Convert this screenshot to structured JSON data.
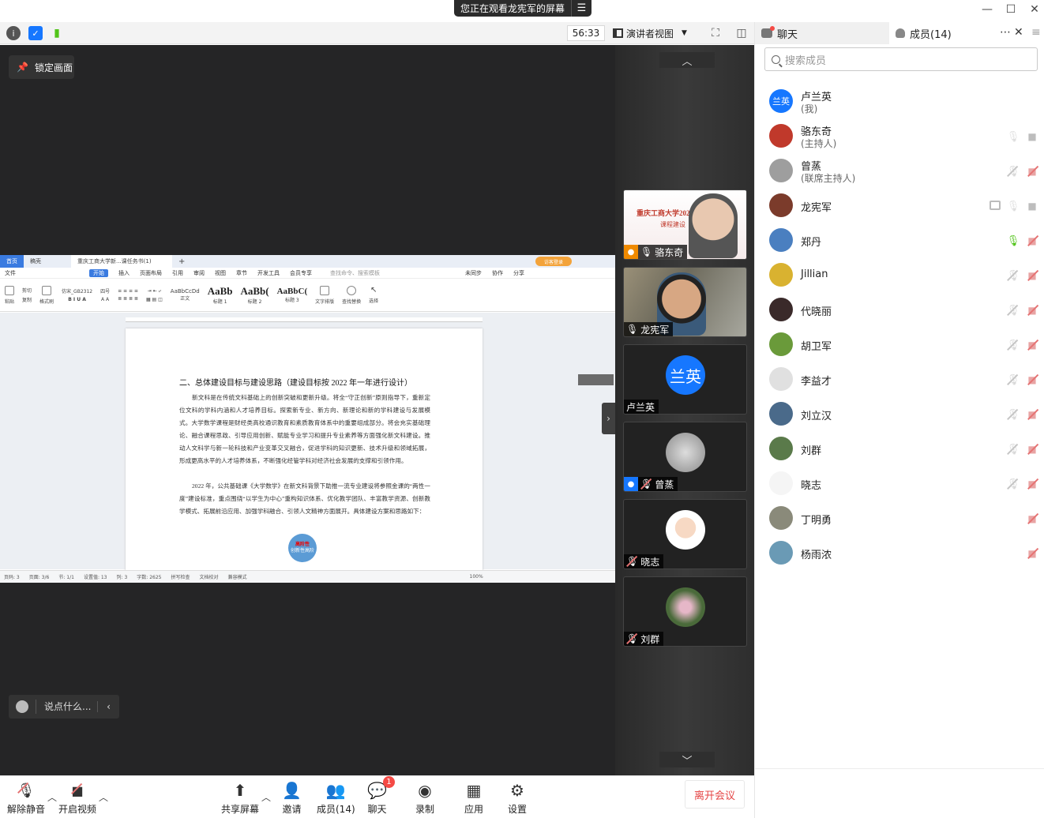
{
  "banner": {
    "text": "您正在观看龙宪军的屏幕",
    "menu_icon": "list-icon"
  },
  "toolbar": {
    "timer": "56:33",
    "view_label": "演讲者视图",
    "icons": [
      "info-icon",
      "shield-icon",
      "signal-icon",
      "fullscreen-icon",
      "layout-icon"
    ]
  },
  "stage": {
    "lock_label": "锁定画面",
    "chat_placeholder": "说点什么..."
  },
  "document": {
    "tabs": [
      "首页",
      "稿壳",
      "重庆工商大学新...课任务书(1)"
    ],
    "login_label": "访客登录",
    "menu": [
      "文件",
      "开始",
      "插入",
      "页面布局",
      "引用",
      "审阅",
      "视图",
      "章节",
      "开发工具",
      "会员专享"
    ],
    "search_placeholder": "查找命令、搜索模板",
    "menu_right": [
      "未同步",
      "协作",
      "分享"
    ],
    "ribbon_font": "仿宋_GB2312",
    "ribbon_size": "四号",
    "ribbon_left": [
      "粘贴",
      "剪切",
      "复制",
      "格式刷"
    ],
    "styles": [
      {
        "sample": "AaBbCcDd",
        "name": "正文"
      },
      {
        "sample": "AaBb",
        "name": "标题 1"
      },
      {
        "sample": "AaBb(",
        "name": "标题 2"
      },
      {
        "sample": "AaBbC(",
        "name": "标题 3"
      }
    ],
    "ribbon_right": [
      "文字排版",
      "查找替换",
      "选择"
    ],
    "heading": "二、总体建设目标与建设思路（建设目标按 2022 年一年进行设计）",
    "paragraph1": "新文科是在传统文科基础上的创新突破和更新升级。将全“守正创新”原则指导下，重新定位文科的学科内涵和人才培养目标。探索新专业、新方向、新理论和新的学科建设与发展模式。大学数学课程是财经类高校通识教育和素质教育体系中的重要组成部分。将会充实基础理论、融合课程思政、引导应用创新、赋能专业学习和提升专业素养等方面强化新文科建设。推动人文科学与新一轮科技和产业变革交叉融合，促进学科的知识更新、技术升级和领域拓展，形成更高水平的人才培养体系，不断强化经管学科对经济社会发展的支撑和引领作用。",
    "paragraph2": "2022 年，公共基础课《大学数学》在新文科背景下助推一流专业建设将参照金课的“两性一度”建设标准，重点围绕“以学生为中心”重构知识体系、优化教学团队、丰富教学资源、创新教学模式、拓展前沿应用、加强学科融合、引领人文精神方面展开。具体建设方案和思路如下：",
    "badge_line1": "高阶性",
    "badge_line2": "创新性高阶",
    "status": [
      "页码: 3",
      "页面: 3/6",
      "节: 1/1",
      "设置值: 13",
      "列: 3",
      "字数: 2625",
      "拼写检查",
      "文档校对",
      "兼容模式",
      "100%"
    ]
  },
  "video_tiles": [
    {
      "name": "骆东奇",
      "mic": "on",
      "role": "host",
      "feed": "slide",
      "slide_title": "重庆工商大学2022",
      "slide_sub": "课程建设"
    },
    {
      "name": "龙宪军",
      "mic": "on",
      "feed": "camera"
    },
    {
      "name": "卢兰英",
      "avatar_text": "兰英",
      "avatar_color": "#1677ff"
    },
    {
      "name": "曾蒸",
      "mic": "off",
      "role": "cohost",
      "avatar_color": "#9e9e9e"
    },
    {
      "name": "晓志",
      "mic": "off",
      "avatar_color": "#f5f5f5"
    },
    {
      "name": "刘群",
      "mic": "off",
      "avatar_color": "#5a7a4a"
    }
  ],
  "bottom_bar": {
    "unmute": "解除静音",
    "start_video": "开启视频",
    "share_screen": "共享屏幕",
    "invite": "邀请",
    "members": "成员(14)",
    "chat": "聊天",
    "chat_badge": "1",
    "record": "录制",
    "apps": "应用",
    "settings": "设置",
    "leave": "离开会议"
  },
  "panel": {
    "tab_chat": "聊天",
    "tab_members": "成员(14)",
    "search_placeholder": "搜索成员",
    "members": [
      {
        "name": "卢兰英",
        "role": "(我)",
        "avatar_text": "兰英",
        "avatar_color": "#1677ff",
        "mic": "none",
        "cam": "none"
      },
      {
        "name": "骆东奇",
        "role": "(主持人)",
        "avatar_color": "#c0392b",
        "mic": "grey",
        "cam": "grey"
      },
      {
        "name": "曾蒸",
        "role": "(联席主持人)",
        "avatar_color": "#9e9e9e",
        "mic": "muted",
        "cam": "muted"
      },
      {
        "name": "龙宪军",
        "avatar_color": "#7b3b2b",
        "mic": "grey",
        "cam": "grey",
        "screen": "true"
      },
      {
        "name": "郑丹",
        "avatar_color": "#4a7fc0",
        "mic": "green",
        "cam": "muted"
      },
      {
        "name": "Jillian",
        "avatar_color": "#d9b230",
        "mic": "muted",
        "cam": "muted"
      },
      {
        "name": "代晓丽",
        "avatar_color": "#3a2a2a",
        "mic": "muted",
        "cam": "muted"
      },
      {
        "name": "胡卫军",
        "avatar_color": "#6a9a3a",
        "mic": "muted",
        "cam": "muted"
      },
      {
        "name": "李益才",
        "avatar_color": "#e0e0e0",
        "mic": "muted",
        "cam": "muted"
      },
      {
        "name": "刘立汉",
        "avatar_color": "#4a6a8a",
        "mic": "muted",
        "cam": "muted"
      },
      {
        "name": "刘群",
        "avatar_color": "#5a7a4a",
        "mic": "muted",
        "cam": "muted"
      },
      {
        "name": "晓志",
        "avatar_color": "#f5f5f5",
        "mic": "muted",
        "cam": "muted"
      },
      {
        "name": "丁明勇",
        "avatar_color": "#8a8a7a",
        "mic": "none",
        "cam": "muted"
      },
      {
        "name": "杨雨浓",
        "avatar_color": "#6a9ab5",
        "mic": "none",
        "cam": "muted"
      }
    ]
  }
}
